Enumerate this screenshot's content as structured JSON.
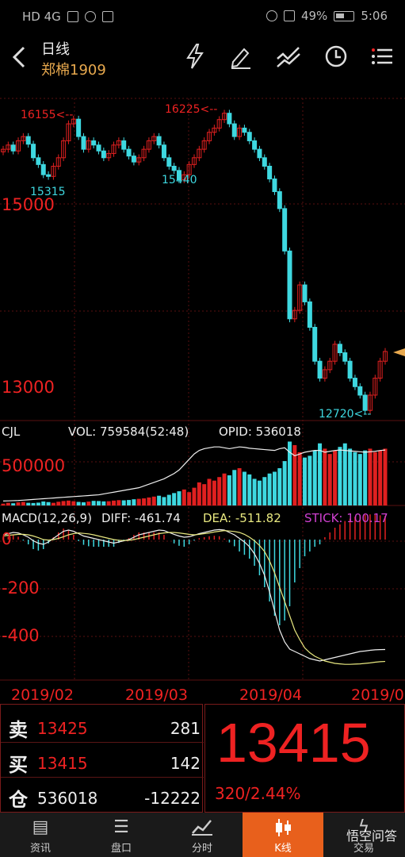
{
  "status_bar": {
    "network": "HD 4G",
    "battery": "49%",
    "time": "5:06"
  },
  "header": {
    "title": "日线",
    "subtitle": "郑棉1909"
  },
  "chart": {
    "price_labels": {
      "high1": "16155<--",
      "high2": "16225<--",
      "low1": "15315",
      "low2": "15440",
      "level_15000": "15000",
      "level_13000": "13000",
      "low3": "12720<--"
    },
    "volume_header": {
      "title": "CJL",
      "vol": "VOL: 759584(52:48)",
      "opid": "OPID: 536018"
    },
    "volume_axis": "500000",
    "macd_header": {
      "title": "MACD(12,26,9)",
      "diff": "DIFF: -461.74",
      "dea": "DEA: -511.82",
      "stick": "STICK: 100.17"
    },
    "macd_axis": {
      "zero": "0",
      "m200": "-200",
      "m400": "-400"
    },
    "dates": [
      "2019/02",
      "2019/03",
      "2019/04",
      "2019/0"
    ],
    "colors": {
      "up": "#e02020",
      "down": "#3ed8e0",
      "dea": "#e8e880",
      "grid": "#5a1010"
    }
  },
  "chart_data": {
    "type": "candlestick",
    "price_range": [
      12600,
      16400
    ],
    "closes": [
      15800,
      15850,
      15780,
      15900,
      15950,
      15860,
      15700,
      15620,
      15500,
      15480,
      15600,
      15700,
      15900,
      16100,
      16155,
      15950,
      15800,
      15900,
      15850,
      15780,
      15700,
      15750,
      15850,
      15900,
      15800,
      15720,
      15650,
      15700,
      15800,
      15900,
      15950,
      15850,
      15700,
      15600,
      15550,
      15440,
      15500,
      15620,
      15700,
      15800,
      15900,
      16000,
      16050,
      16150,
      16225,
      16100,
      15950,
      16050,
      16000,
      15900,
      15800,
      15700,
      15600,
      15450,
      15300,
      15100,
      14600,
      13800,
      13900,
      14200,
      14000,
      13700,
      13300,
      13100,
      13200,
      13300,
      13500,
      13400,
      13300,
      13100,
      13000,
      12900,
      12720,
      12900,
      13100,
      13300,
      13415
    ],
    "volumes": [
      20,
      30,
      25,
      35,
      40,
      30,
      28,
      32,
      45,
      38,
      30,
      42,
      50,
      55,
      48,
      40,
      36,
      44,
      52,
      50,
      46,
      48,
      55,
      60,
      58,
      62,
      70,
      75,
      80,
      90,
      100,
      110,
      95,
      120,
      140,
      160,
      180,
      150,
      200,
      260,
      240,
      300,
      280,
      320,
      360,
      340,
      400,
      420,
      380,
      350,
      300,
      280,
      320,
      360,
      380,
      420,
      500,
      720,
      680,
      600,
      540,
      560,
      620,
      700,
      640,
      580,
      620,
      660,
      700,
      640,
      600,
      580,
      620,
      640,
      600,
      620,
      640
    ],
    "opid": [
      50,
      52,
      54,
      56,
      60,
      64,
      68,
      72,
      76,
      80,
      84,
      88,
      92,
      96,
      100,
      104,
      108,
      112,
      116,
      120,
      130,
      140,
      150,
      160,
      170,
      180,
      190,
      200,
      220,
      240,
      260,
      280,
      300,
      330,
      360,
      400,
      460,
      520,
      580,
      620,
      640,
      650,
      660,
      660,
      650,
      640,
      650,
      660,
      655,
      645,
      640,
      635,
      630,
      625,
      620,
      640,
      650,
      600,
      560,
      580,
      600,
      610,
      620,
      620,
      600,
      610,
      620,
      625,
      620,
      615,
      610,
      605,
      600,
      605,
      610,
      620,
      625
    ],
    "diff": [
      20,
      25,
      30,
      28,
      20,
      10,
      -5,
      -15,
      -20,
      -10,
      5,
      20,
      35,
      40,
      35,
      25,
      15,
      10,
      5,
      0,
      -5,
      -10,
      -15,
      -10,
      -5,
      0,
      10,
      20,
      25,
      30,
      35,
      40,
      38,
      30,
      22,
      15,
      10,
      12,
      18,
      25,
      30,
      35,
      40,
      42,
      40,
      30,
      20,
      5,
      -10,
      -30,
      -60,
      -100,
      -150,
      -220,
      -300,
      -380,
      -430,
      -460,
      -470,
      -480,
      -490,
      -500,
      -505,
      -510,
      -505,
      -500,
      -495,
      -490,
      -485,
      -480,
      -475,
      -470,
      -468,
      -465,
      -463,
      -462,
      -461.74
    ],
    "dea": [
      15,
      18,
      20,
      22,
      22,
      20,
      15,
      8,
      0,
      -2,
      0,
      5,
      12,
      20,
      25,
      28,
      26,
      24,
      20,
      15,
      10,
      5,
      0,
      -3,
      -4,
      -3,
      0,
      5,
      10,
      15,
      20,
      25,
      28,
      30,
      30,
      28,
      25,
      22,
      20,
      22,
      25,
      28,
      32,
      35,
      38,
      36,
      34,
      30,
      22,
      10,
      -5,
      -25,
      -50,
      -90,
      -140,
      -200,
      -260,
      -320,
      -380,
      -420,
      -455,
      -475,
      -490,
      -500,
      -510,
      -515,
      -520,
      -522,
      -524,
      -524,
      -523,
      -522,
      -520,
      -518,
      -515,
      -513,
      -511.82
    ],
    "bid_ask": {
      "sell_price": 13425,
      "sell_vol": 281,
      "buy_price": 13415,
      "buy_vol": 142,
      "position": 536018,
      "position_change": -12222
    },
    "last_price": 13415
  },
  "quote": {
    "sell_label": "卖",
    "sell_price": "13425",
    "sell_vol": "281",
    "buy_label": "买",
    "buy_price": "13415",
    "buy_vol": "142",
    "pos_label": "仓",
    "pos_value": "536018",
    "pos_change": "-12222",
    "last_price": "13415",
    "change": "320/2.44%"
  },
  "tabs": [
    {
      "label": "资讯",
      "icon": "news-icon"
    },
    {
      "label": "盘口",
      "icon": "orderbook-icon"
    },
    {
      "label": "分时",
      "icon": "intraday-icon"
    },
    {
      "label": "K线",
      "icon": "candlestick-icon",
      "active": true
    },
    {
      "label": "交易",
      "icon": "lightning-icon"
    }
  ],
  "watermark": "悟空问答"
}
